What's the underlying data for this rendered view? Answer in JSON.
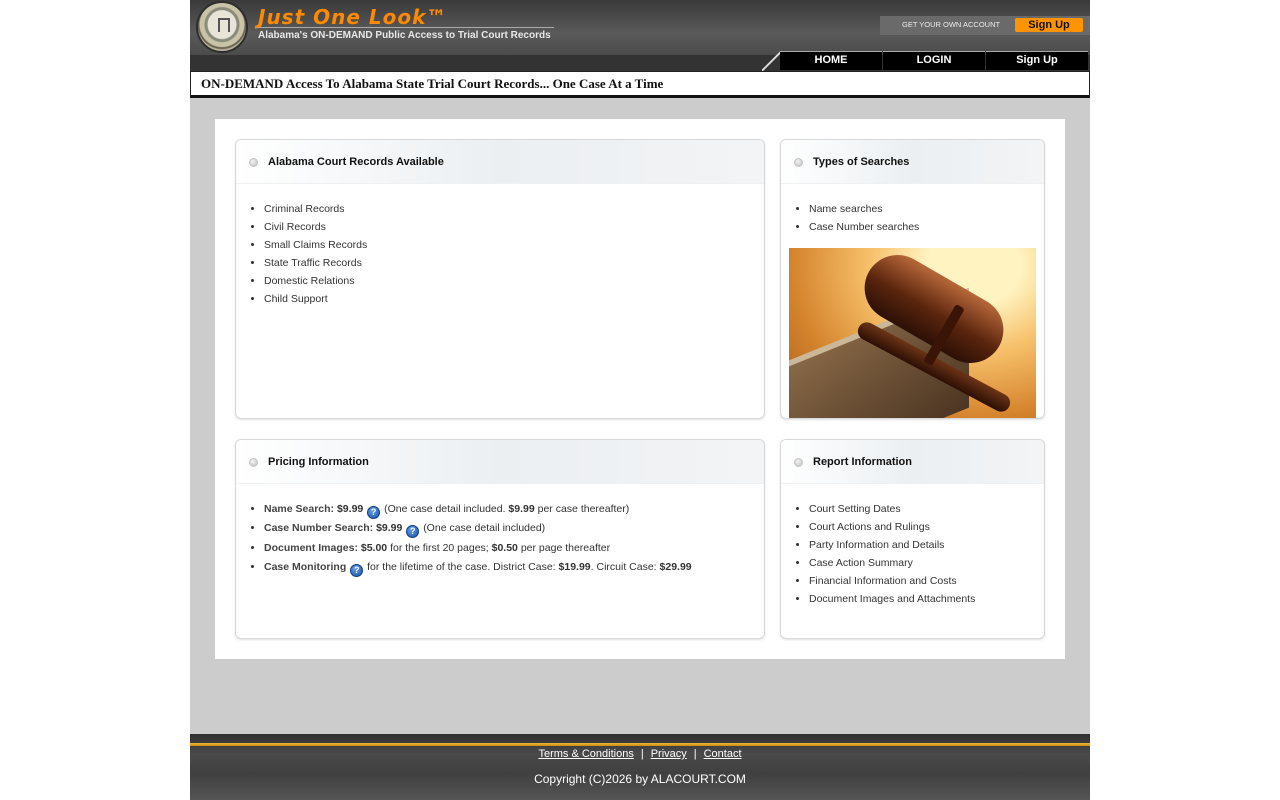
{
  "header": {
    "brand_title": "Just One Look™",
    "brand_subtitle": "Alabama's ON-DEMAND Public Access to Trial Court Records",
    "account_caption": "GET YOUR OWN ACCOUNT",
    "signup_label": "Sign Up"
  },
  "nav": {
    "items": [
      {
        "label": "HOME"
      },
      {
        "label": "LOGIN"
      },
      {
        "label": "Sign Up"
      }
    ]
  },
  "tagline": "ON-DEMAND Access To Alabama State Trial Court Records... One Case At a Time",
  "panels": {
    "records": {
      "title": "Alabama Court Records Available",
      "items": [
        "Criminal Records",
        "Civil Records",
        "Small Claims Records",
        "State Traffic Records",
        "Domestic Relations",
        "Child Support"
      ]
    },
    "types": {
      "title": "Types of Searches",
      "items": [
        "Name searches",
        "Case Number searches"
      ]
    },
    "pricing": {
      "title": "Pricing Information",
      "name_search": {
        "label": "Name Search:",
        "price": "$9.99",
        "text_a": "(One case detail included.",
        "price2": "$9.99",
        "text_b": "per case thereafter)"
      },
      "case_number_search": {
        "label": "Case Number Search:",
        "price": "$9.99",
        "text": "(One case detail included)"
      },
      "document_images": {
        "label": "Document Images:",
        "price": "$5.00",
        "text_a": "for the first 20 pages;",
        "price2": "$0.50",
        "text_b": "per page thereafter"
      },
      "case_monitoring": {
        "label": "Case Monitoring",
        "text_a": "for the lifetime of the case. District Case:",
        "price": "$19.99",
        "text_b": ". Circuit Case:",
        "price2": "$29.99"
      },
      "help_glyph": "?"
    },
    "report": {
      "title": "Report Information",
      "items": [
        "Court Setting Dates",
        "Court Actions and Rulings",
        "Party Information and Details",
        "Case Action Summary",
        "Financial Information and Costs",
        "Document Images and Attachments"
      ]
    }
  },
  "footer": {
    "terms": "Terms & Conditions",
    "privacy": "Privacy",
    "contact": "Contact",
    "separator": "|",
    "copyright": "Copyright (C)2026 by ALACOURT.COM"
  },
  "colors": {
    "brand_orange": "#ff8a00",
    "signup_orange": "#ff9400",
    "footer_stripe": "#f0b838"
  }
}
